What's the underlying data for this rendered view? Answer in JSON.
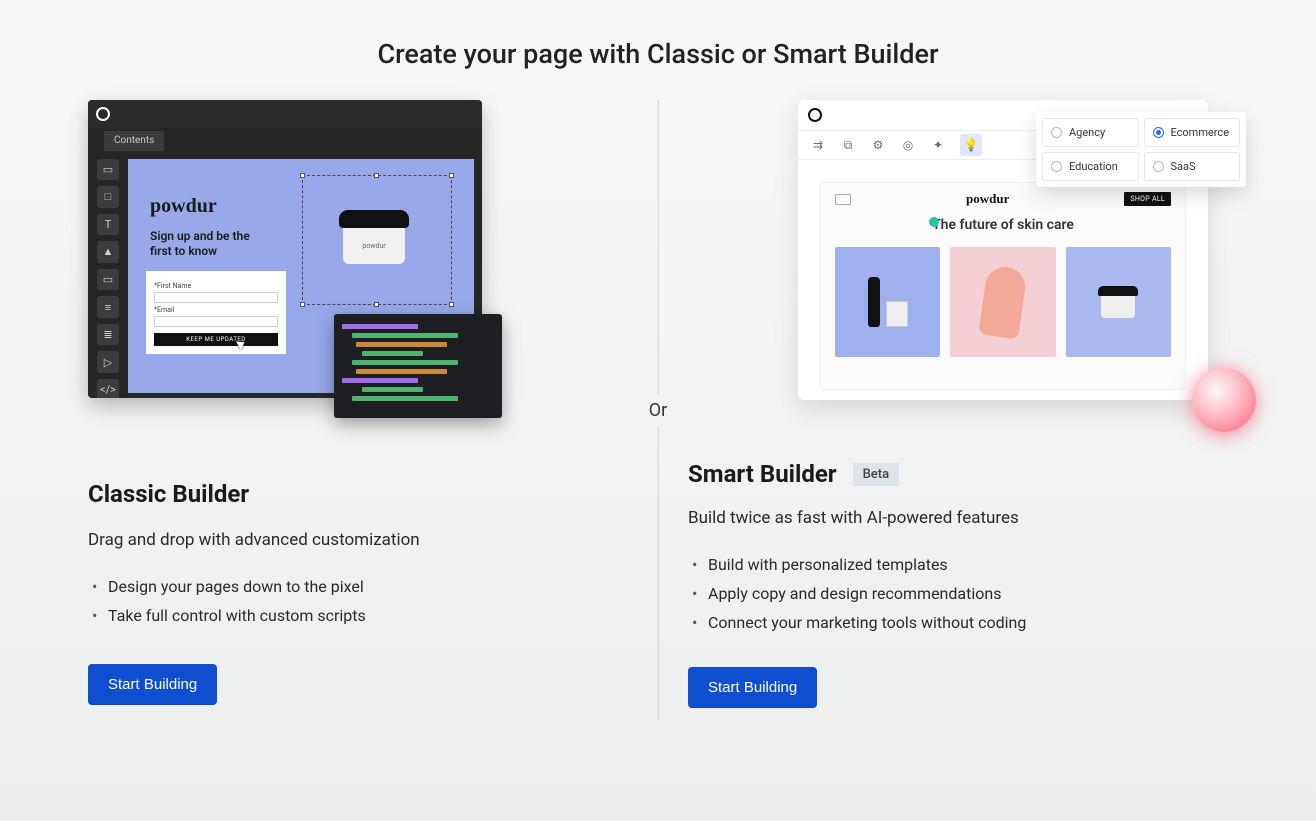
{
  "title": "Create your page with Classic or Smart Builder",
  "divider": "Or",
  "classic": {
    "tab": "Contents",
    "preview": {
      "brand": "powdur",
      "headline": "Sign up and be the first to know",
      "form": {
        "firstNameLabel": "*First Name",
        "emailLabel": "*Email",
        "button": "KEEP ME UPDATED"
      },
      "itemLabel": "powdur"
    },
    "title": "Classic Builder",
    "subtitle": "Drag and drop with advanced customization",
    "bullets": [
      "Design your pages down to the pixel",
      "Take full control with custom scripts"
    ],
    "cta": "Start Building"
  },
  "smart": {
    "categories": [
      {
        "label": "Agency",
        "selected": false
      },
      {
        "label": "Ecommerce",
        "selected": true
      },
      {
        "label": "Education",
        "selected": false
      },
      {
        "label": "SaaS",
        "selected": false
      }
    ],
    "preview": {
      "brand": "powdur",
      "shop": "SHOP ALL",
      "headline": "The future of skin care"
    },
    "title": "Smart Builder",
    "badge": "Beta",
    "subtitle": "Build twice as fast with AI-powered features",
    "bullets": [
      "Build with personalized templates",
      "Apply copy and design recommendations",
      "Connect your marketing tools without coding"
    ],
    "cta": "Start Building"
  }
}
